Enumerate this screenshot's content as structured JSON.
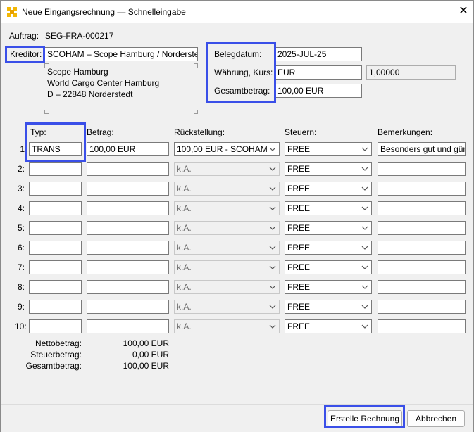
{
  "window": {
    "title": "Neue Eingangsrechnung — Schnelleingabe",
    "close_glyph": "✕"
  },
  "header": {
    "auftrag_label": "Auftrag:",
    "auftrag_value": "SEG-FRA-000217",
    "kreditor_label": "Kreditor:",
    "kreditor_value": "SCOHAM – Scope Hamburg / Norderstedt",
    "address": [
      "Scope Hamburg",
      "World Cargo Center Hamburg",
      "D – 22848 Norderstedt"
    ],
    "belegdatum_label": "Belegdatum:",
    "belegdatum_value": "2025-JUL-25",
    "waehrung_label": "Währung, Kurs:",
    "waehrung_value": "EUR",
    "kurs_value": "1,00000",
    "gesamtbetrag_label": "Gesamtbetrag:",
    "gesamtbetrag_value": "100,00 EUR"
  },
  "grid": {
    "headers": {
      "typ": "Typ:",
      "betrag": "Betrag:",
      "rueckstellung": "Rückstellung:",
      "steuern": "Steuern:",
      "bemerkungen": "Bemerkungen:"
    },
    "rows": [
      {
        "num": "1",
        "typ": "TRANS",
        "betrag": "100,00 EUR",
        "rueckstellung": "100,00 EUR - SCOHAM",
        "steuern": "FREE",
        "bemerkung": "Besonders gut und günstig"
      },
      {
        "num": "2:",
        "typ": "",
        "betrag": "",
        "rueckstellung": "k.A.",
        "steuern": "FREE",
        "bemerkung": ""
      },
      {
        "num": "3:",
        "typ": "",
        "betrag": "",
        "rueckstellung": "k.A.",
        "steuern": "FREE",
        "bemerkung": ""
      },
      {
        "num": "4:",
        "typ": "",
        "betrag": "",
        "rueckstellung": "k.A.",
        "steuern": "FREE",
        "bemerkung": ""
      },
      {
        "num": "5:",
        "typ": "",
        "betrag": "",
        "rueckstellung": "k.A.",
        "steuern": "FREE",
        "bemerkung": ""
      },
      {
        "num": "6:",
        "typ": "",
        "betrag": "",
        "rueckstellung": "k.A.",
        "steuern": "FREE",
        "bemerkung": ""
      },
      {
        "num": "7:",
        "typ": "",
        "betrag": "",
        "rueckstellung": "k.A.",
        "steuern": "FREE",
        "bemerkung": ""
      },
      {
        "num": "8:",
        "typ": "",
        "betrag": "",
        "rueckstellung": "k.A.",
        "steuern": "FREE",
        "bemerkung": ""
      },
      {
        "num": "9:",
        "typ": "",
        "betrag": "",
        "rueckstellung": "k.A.",
        "steuern": "FREE",
        "bemerkung": ""
      },
      {
        "num": "10:",
        "typ": "",
        "betrag": "",
        "rueckstellung": "k.A.",
        "steuern": "FREE",
        "bemerkung": ""
      }
    ]
  },
  "summary": {
    "netto_label": "Nettobetrag:",
    "netto_value": "100,00 EUR",
    "steuer_label": "Steuerbetrag:",
    "steuer_value": "0,00 EUR",
    "gesamt_label": "Gesamtbetrag:",
    "gesamt_value": "100,00 EUR"
  },
  "footer": {
    "create_label": "Erstelle Rechnung",
    "cancel_label": "Abbrechen"
  },
  "colors": {
    "highlight": "#3a4fe8",
    "app_icon": "#f2b705"
  }
}
